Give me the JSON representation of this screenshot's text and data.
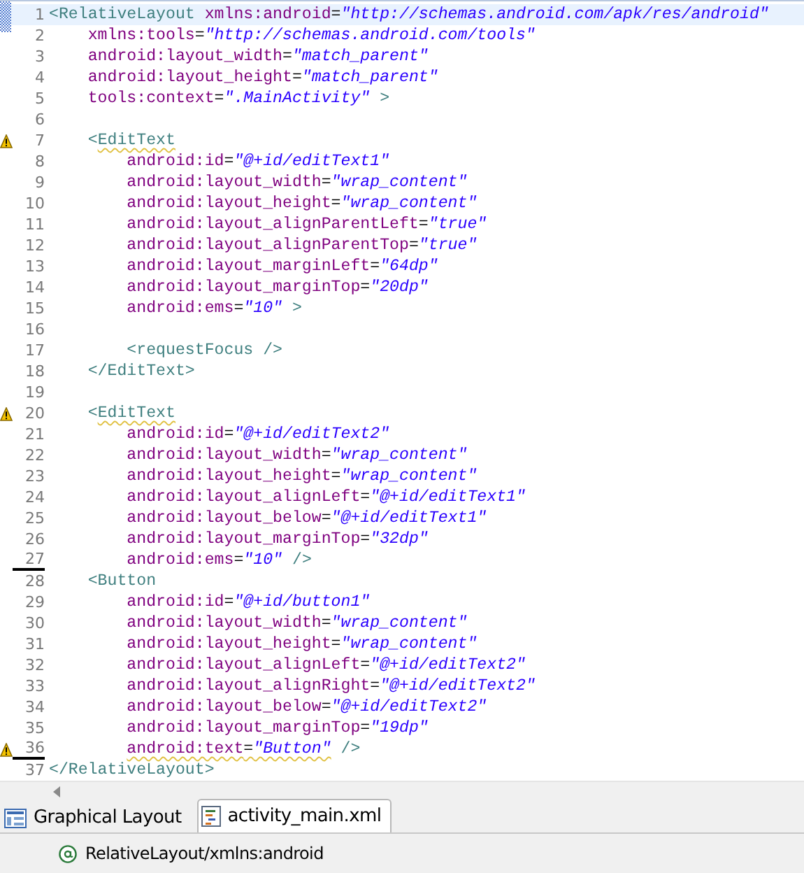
{
  "editor": {
    "lines": [
      {
        "number": "1",
        "warning": false,
        "current": true,
        "changed": false,
        "tokens": [
          {
            "kind": "tag",
            "text": "<RelativeLayout"
          },
          {
            "kind": "attr",
            "text": " xmlns:android"
          },
          {
            "kind": "eq",
            "text": "="
          },
          {
            "kind": "value",
            "text": "\"http://schemas.android.com/apk/res/android\""
          }
        ]
      },
      {
        "number": "2",
        "warning": false,
        "current": false,
        "changed": false,
        "tokens": [
          {
            "kind": "attr",
            "text": "    xmlns:tools"
          },
          {
            "kind": "eq",
            "text": "="
          },
          {
            "kind": "value",
            "text": "\"http://schemas.android.com/tools\""
          }
        ]
      },
      {
        "number": "3",
        "warning": false,
        "current": false,
        "changed": false,
        "tokens": [
          {
            "kind": "attr",
            "text": "    android:layout_width"
          },
          {
            "kind": "eq",
            "text": "="
          },
          {
            "kind": "value",
            "text": "\"match_parent\""
          }
        ]
      },
      {
        "number": "4",
        "warning": false,
        "current": false,
        "changed": false,
        "tokens": [
          {
            "kind": "attr",
            "text": "    android:layout_height"
          },
          {
            "kind": "eq",
            "text": "="
          },
          {
            "kind": "value",
            "text": "\"match_parent\""
          }
        ]
      },
      {
        "number": "5",
        "warning": false,
        "current": false,
        "changed": false,
        "tokens": [
          {
            "kind": "attr",
            "text": "    tools:context"
          },
          {
            "kind": "eq",
            "text": "="
          },
          {
            "kind": "value",
            "text": "\".MainActivity\""
          },
          {
            "kind": "tag",
            "text": " >"
          }
        ]
      },
      {
        "number": "6",
        "warning": false,
        "current": false,
        "changed": false
      },
      {
        "number": "7",
        "warning": true,
        "current": false,
        "changed": false,
        "tokens": [
          {
            "kind": "tag",
            "text": "    <"
          },
          {
            "kind": "warntag",
            "text": "EditText"
          }
        ]
      },
      {
        "number": "8",
        "warning": false,
        "current": false,
        "changed": false,
        "tokens": [
          {
            "kind": "attr",
            "text": "        android:id"
          },
          {
            "kind": "eq",
            "text": "="
          },
          {
            "kind": "value",
            "text": "\"@+id/editText1\""
          }
        ]
      },
      {
        "number": "9",
        "warning": false,
        "current": false,
        "changed": false,
        "tokens": [
          {
            "kind": "attr",
            "text": "        android:layout_width"
          },
          {
            "kind": "eq",
            "text": "="
          },
          {
            "kind": "value",
            "text": "\"wrap_content\""
          }
        ]
      },
      {
        "number": "10",
        "warning": false,
        "current": false,
        "changed": false,
        "tokens": [
          {
            "kind": "attr",
            "text": "        android:layout_height"
          },
          {
            "kind": "eq",
            "text": "="
          },
          {
            "kind": "value",
            "text": "\"wrap_content\""
          }
        ]
      },
      {
        "number": "11",
        "warning": false,
        "current": false,
        "changed": false,
        "tokens": [
          {
            "kind": "attr",
            "text": "        android:layout_alignParentLeft"
          },
          {
            "kind": "eq",
            "text": "="
          },
          {
            "kind": "value",
            "text": "\"true\""
          }
        ]
      },
      {
        "number": "12",
        "warning": false,
        "current": false,
        "changed": false,
        "tokens": [
          {
            "kind": "attr",
            "text": "        android:layout_alignParentTop"
          },
          {
            "kind": "eq",
            "text": "="
          },
          {
            "kind": "value",
            "text": "\"true\""
          }
        ]
      },
      {
        "number": "13",
        "warning": false,
        "current": false,
        "changed": false,
        "tokens": [
          {
            "kind": "attr",
            "text": "        android:layout_marginLeft"
          },
          {
            "kind": "eq",
            "text": "="
          },
          {
            "kind": "value",
            "text": "\"64dp\""
          }
        ]
      },
      {
        "number": "14",
        "warning": false,
        "current": false,
        "changed": false,
        "tokens": [
          {
            "kind": "attr",
            "text": "        android:layout_marginTop"
          },
          {
            "kind": "eq",
            "text": "="
          },
          {
            "kind": "value",
            "text": "\"20dp\""
          }
        ]
      },
      {
        "number": "15",
        "warning": false,
        "current": false,
        "changed": false,
        "tokens": [
          {
            "kind": "attr",
            "text": "        android:ems"
          },
          {
            "kind": "eq",
            "text": "="
          },
          {
            "kind": "value",
            "text": "\"10\""
          },
          {
            "kind": "tag",
            "text": " >"
          }
        ]
      },
      {
        "number": "16",
        "warning": false,
        "current": false,
        "changed": false
      },
      {
        "number": "17",
        "warning": false,
        "current": false,
        "changed": false,
        "tokens": [
          {
            "kind": "tag",
            "text": "        <requestFocus />"
          }
        ]
      },
      {
        "number": "18",
        "warning": false,
        "current": false,
        "changed": false,
        "tokens": [
          {
            "kind": "tag",
            "text": "    </EditText>"
          }
        ]
      },
      {
        "number": "19",
        "warning": false,
        "current": false,
        "changed": false
      },
      {
        "number": "20",
        "warning": true,
        "current": false,
        "changed": false,
        "tokens": [
          {
            "kind": "tag",
            "text": "    <"
          },
          {
            "kind": "warntag",
            "text": "EditText"
          }
        ]
      },
      {
        "number": "21",
        "warning": false,
        "current": false,
        "changed": false,
        "tokens": [
          {
            "kind": "attr",
            "text": "        android:id"
          },
          {
            "kind": "eq",
            "text": "="
          },
          {
            "kind": "value",
            "text": "\"@+id/editText2\""
          }
        ]
      },
      {
        "number": "22",
        "warning": false,
        "current": false,
        "changed": false,
        "tokens": [
          {
            "kind": "attr",
            "text": "        android:layout_width"
          },
          {
            "kind": "eq",
            "text": "="
          },
          {
            "kind": "value",
            "text": "\"wrap_content\""
          }
        ]
      },
      {
        "number": "23",
        "warning": false,
        "current": false,
        "changed": false,
        "tokens": [
          {
            "kind": "attr",
            "text": "        android:layout_height"
          },
          {
            "kind": "eq",
            "text": "="
          },
          {
            "kind": "value",
            "text": "\"wrap_content\""
          }
        ]
      },
      {
        "number": "24",
        "warning": false,
        "current": false,
        "changed": false,
        "tokens": [
          {
            "kind": "attr",
            "text": "        android:layout_alignLeft"
          },
          {
            "kind": "eq",
            "text": "="
          },
          {
            "kind": "value",
            "text": "\"@+id/editText1\""
          }
        ]
      },
      {
        "number": "25",
        "warning": false,
        "current": false,
        "changed": false,
        "tokens": [
          {
            "kind": "attr",
            "text": "        android:layout_below"
          },
          {
            "kind": "eq",
            "text": "="
          },
          {
            "kind": "value",
            "text": "\"@+id/editText1\""
          }
        ]
      },
      {
        "number": "26",
        "warning": false,
        "current": false,
        "changed": false,
        "tokens": [
          {
            "kind": "attr",
            "text": "        android:layout_marginTop"
          },
          {
            "kind": "eq",
            "text": "="
          },
          {
            "kind": "value",
            "text": "\"32dp\""
          }
        ]
      },
      {
        "number": "27",
        "warning": false,
        "current": false,
        "changed": true,
        "tokens": [
          {
            "kind": "attr",
            "text": "        android:ems"
          },
          {
            "kind": "eq",
            "text": "="
          },
          {
            "kind": "value",
            "text": "\"10\""
          },
          {
            "kind": "tag",
            "text": " />"
          }
        ]
      },
      {
        "number": "28",
        "warning": false,
        "current": false,
        "changed": false,
        "tokens": [
          {
            "kind": "tag",
            "text": "    <Button"
          }
        ]
      },
      {
        "number": "29",
        "warning": false,
        "current": false,
        "changed": false,
        "tokens": [
          {
            "kind": "attr",
            "text": "        android:id"
          },
          {
            "kind": "eq",
            "text": "="
          },
          {
            "kind": "value",
            "text": "\"@+id/button1\""
          }
        ]
      },
      {
        "number": "30",
        "warning": false,
        "current": false,
        "changed": false,
        "tokens": [
          {
            "kind": "attr",
            "text": "        android:layout_width"
          },
          {
            "kind": "eq",
            "text": "="
          },
          {
            "kind": "value",
            "text": "\"wrap_content\""
          }
        ]
      },
      {
        "number": "31",
        "warning": false,
        "current": false,
        "changed": false,
        "tokens": [
          {
            "kind": "attr",
            "text": "        android:layout_height"
          },
          {
            "kind": "eq",
            "text": "="
          },
          {
            "kind": "value",
            "text": "\"wrap_content\""
          }
        ]
      },
      {
        "number": "32",
        "warning": false,
        "current": false,
        "changed": false,
        "tokens": [
          {
            "kind": "attr",
            "text": "        android:layout_alignLeft"
          },
          {
            "kind": "eq",
            "text": "="
          },
          {
            "kind": "value",
            "text": "\"@+id/editText2\""
          }
        ]
      },
      {
        "number": "33",
        "warning": false,
        "current": false,
        "changed": false,
        "tokens": [
          {
            "kind": "attr",
            "text": "        android:layout_alignRight"
          },
          {
            "kind": "eq",
            "text": "="
          },
          {
            "kind": "value",
            "text": "\"@+id/editText2\""
          }
        ]
      },
      {
        "number": "34",
        "warning": false,
        "current": false,
        "changed": false,
        "tokens": [
          {
            "kind": "attr",
            "text": "        android:layout_below"
          },
          {
            "kind": "eq",
            "text": "="
          },
          {
            "kind": "value",
            "text": "\"@+id/editText2\""
          }
        ]
      },
      {
        "number": "35",
        "warning": false,
        "current": false,
        "changed": false,
        "tokens": [
          {
            "kind": "attr",
            "text": "        android:layout_marginTop"
          },
          {
            "kind": "eq",
            "text": "="
          },
          {
            "kind": "value",
            "text": "\"19dp\""
          }
        ]
      },
      {
        "number": "36",
        "warning": true,
        "current": false,
        "changed": true,
        "tokens": [
          {
            "kind": "warnattr",
            "text": "        android:text"
          },
          {
            "kind": "warneq",
            "text": "="
          },
          {
            "kind": "warnvalue",
            "text": "\"Button\""
          },
          {
            "kind": "tag",
            "text": " />"
          }
        ]
      },
      {
        "number": "37",
        "warning": false,
        "current": false,
        "changed": false,
        "tokens": [
          {
            "kind": "tag",
            "text": "</RelativeLayout>"
          }
        ]
      }
    ]
  },
  "bottom_tabs": [
    {
      "label": "Graphical Layout",
      "selected": false,
      "kind": "layout"
    },
    {
      "label": "activity_main.xml",
      "selected": true,
      "kind": "xml"
    }
  ],
  "status_bar": {
    "text": "RelativeLayout/xmlns:android"
  }
}
